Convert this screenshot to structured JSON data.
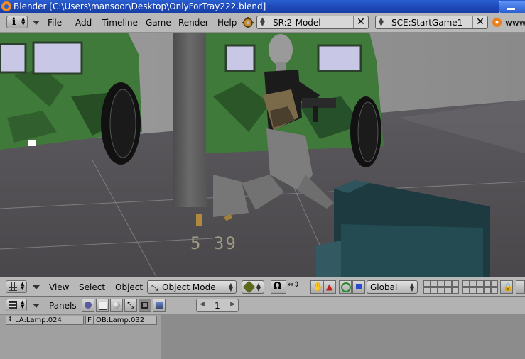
{
  "window": {
    "title": "Blender [C:\\Users\\mansoor\\Desktop\\OnlyForTray222.blend]"
  },
  "infobar": {
    "menus": [
      "File",
      "Add",
      "Timeline",
      "Game",
      "Render",
      "Help"
    ],
    "screen_field": "SR:2-Model",
    "scene_field": "SCE:StartGame1",
    "url_text": "www"
  },
  "viewport": {
    "stats_text": "5 39"
  },
  "view3d_header": {
    "menus": [
      "View",
      "Select",
      "Object"
    ],
    "mode_label": "Object Mode",
    "orientation_label": "Global"
  },
  "buttons_header": {
    "panels_label": "Panels",
    "frame_value": "1"
  },
  "panel": {
    "lamp_block": "LA:Lamp.024",
    "fake_flag": "F",
    "object_block": "OB:Lamp.032"
  },
  "colors": {
    "title_bar": "#1c46b5",
    "header_gray": "#b9b9b9",
    "camo_green": "#3f7a3a"
  }
}
